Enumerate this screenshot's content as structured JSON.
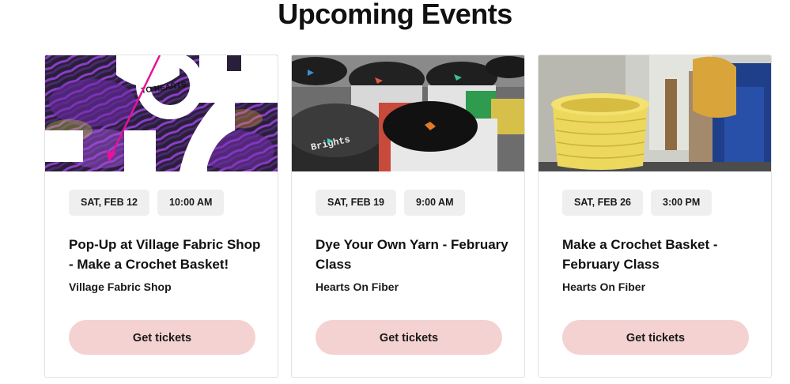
{
  "heading": "Upcoming Events",
  "events": [
    {
      "date": "SAT, FEB 12",
      "time": "10:00 AM",
      "title": "Pop-Up at Village Fabric Shop - Make a Crochet Basket!",
      "venue": "Village Fabric Shop",
      "button": "Get tickets",
      "image_text": "TO HEARTS"
    },
    {
      "date": "SAT, FEB 19",
      "time": "9:00 AM",
      "title": "Dye Your Own Yarn - February Class",
      "venue": "Hearts On Fiber",
      "button": "Get tickets",
      "image_text": "Brights"
    },
    {
      "date": "SAT, FEB 26",
      "time": "3:00 PM",
      "title": "Make a Crochet Basket - February Class",
      "venue": "Hearts On Fiber",
      "button": "Get tickets"
    }
  ],
  "colors": {
    "button_bg": "#f4d2d2",
    "chip_bg": "#efefef",
    "accent_pink": "#e5129b"
  }
}
